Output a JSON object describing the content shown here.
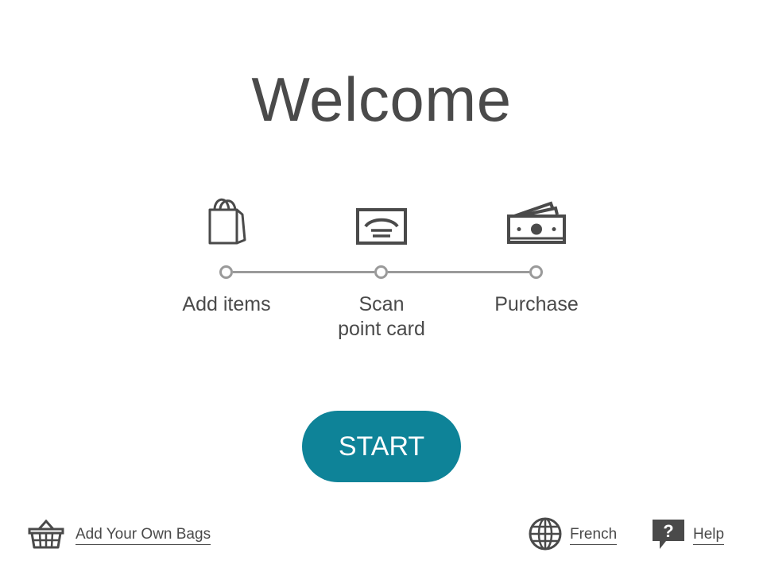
{
  "header": {
    "title": "Welcome"
  },
  "steps": [
    {
      "label": "Add items",
      "icon": "shopping-bag-icon"
    },
    {
      "label": "Scan\npoint card",
      "icon": "card-reader-icon"
    },
    {
      "label": "Purchase",
      "icon": "cash-icon"
    }
  ],
  "start_button": {
    "label": "START",
    "color": "#0e8398"
  },
  "footer": {
    "bags_label": "Add Your Own Bags",
    "bags_icon": "basket-icon",
    "language_label": "French",
    "language_icon": "globe-icon",
    "help_label": "Help",
    "help_icon": "help-bubble-icon"
  }
}
